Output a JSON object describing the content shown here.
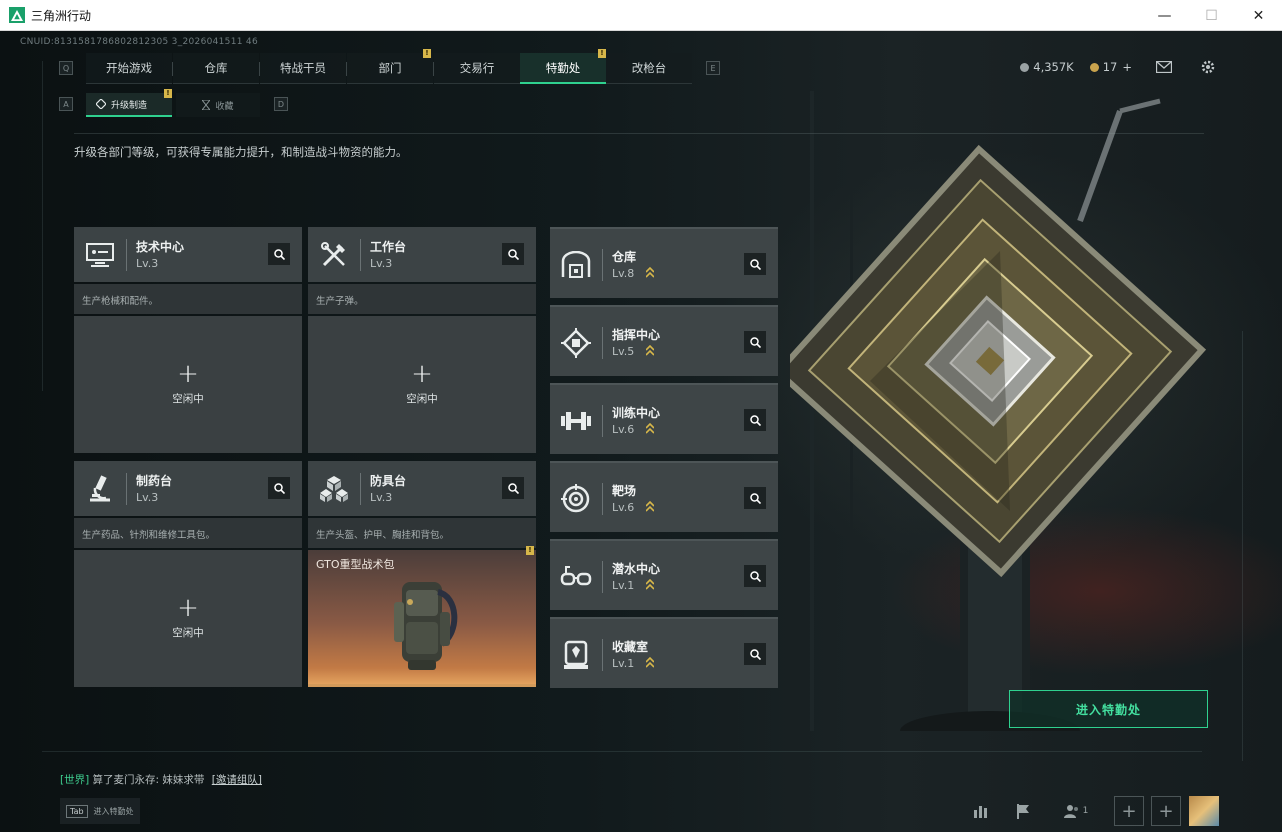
{
  "window": {
    "title": "三角洲行动",
    "minimize": "—",
    "maximize": "☐",
    "close": "✕"
  },
  "uid": "CNUID:8131581786802812305 3_2026041511 46",
  "nav": {
    "left_key": "Q",
    "right_key": "E",
    "items": [
      {
        "label": "开始游戏",
        "active": false,
        "badge": ""
      },
      {
        "label": "仓库",
        "active": false,
        "badge": ""
      },
      {
        "label": "特战干员",
        "active": false,
        "badge": ""
      },
      {
        "label": "部门",
        "active": false,
        "badge": "!"
      },
      {
        "label": "交易行",
        "active": false,
        "badge": ""
      },
      {
        "label": "特勤处",
        "active": true,
        "badge": "!"
      },
      {
        "label": "改枪台",
        "active": false,
        "badge": ""
      }
    ]
  },
  "currency": {
    "coins": "4,357K",
    "coupons": "17",
    "coupons_add": "+"
  },
  "subtabs": {
    "left_key": "A",
    "right_key": "D",
    "upgrade_label": "升级制造",
    "upgrade_badge": "!",
    "collect_label": "收藏"
  },
  "description": "升级各部门等级，可获得专属能力提升，和制造战斗物资的能力。",
  "workshops": [
    {
      "name": "技术中心",
      "level": "Lv.3",
      "desc": "生产枪械和配件。",
      "state": "空闲中",
      "icon": "computer-icon"
    },
    {
      "name": "工作台",
      "level": "Lv.3",
      "desc": "生产子弹。",
      "state": "空闲中",
      "icon": "tools-icon"
    },
    {
      "name": "制药台",
      "level": "Lv.3",
      "desc": "生产药品、针剂和维修工具包。",
      "state": "空闲中",
      "icon": "microscope-icon"
    },
    {
      "name": "防具台",
      "level": "Lv.3",
      "desc": "生产头盔、护甲、胸挂和背包。",
      "item": "GTO重型战术包",
      "item_badge": "!",
      "icon": "cubes-icon"
    }
  ],
  "idle_plus": "+",
  "facilities": [
    {
      "name": "仓库",
      "level": "Lv.8",
      "icon": "warehouse-icon"
    },
    {
      "name": "指挥中心",
      "level": "Lv.5",
      "icon": "chip-icon"
    },
    {
      "name": "训练中心",
      "level": "Lv.6",
      "icon": "dumbbell-icon"
    },
    {
      "name": "靶场",
      "level": "Lv.6",
      "icon": "target-icon"
    },
    {
      "name": "潜水中心",
      "level": "Lv.1",
      "icon": "diving-mask-icon"
    },
    {
      "name": "收藏室",
      "level": "Lv.1",
      "icon": "trophy-room-icon"
    }
  ],
  "enter_button": "进入特勤处",
  "chat": {
    "channel": "[世界]",
    "message": "算了麦门永存: 妹妹求带",
    "invite": "[邀请组队]"
  },
  "tab_hint": {
    "key": "Tab",
    "label": "进入特勤处"
  },
  "friends_count": "1",
  "colors": {
    "accent": "#2fd18f",
    "badge": "#d7b74a",
    "card": "#3c4345"
  }
}
